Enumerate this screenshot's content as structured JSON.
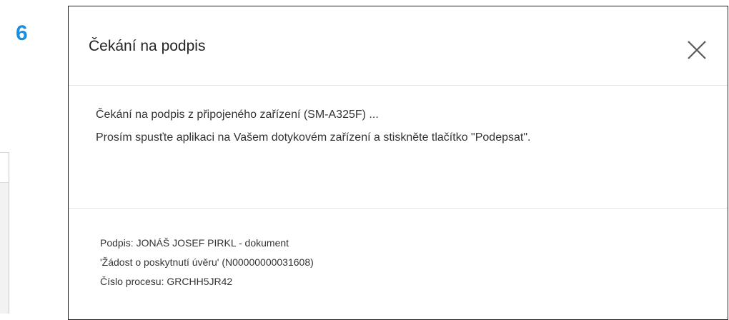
{
  "step": {
    "number": "6"
  },
  "dialog": {
    "title": "Čekání na podpis",
    "close_icon": "close-icon",
    "body": {
      "line1": "Čekání na podpis z připojeného zařízení (SM-A325F) ...",
      "line2": "Prosím spusťte aplikaci na Vašem dotykovém zařízení a stiskněte tlačítko \"Podepsat\"."
    },
    "footer": {
      "line1": "Podpis: JONÁŠ JOSEF PIRKL - dokument",
      "line2": "'Žádost o poskytnutí úvěru' (N00000000031608)",
      "line3": "Číslo procesu: GRCHH5JR42"
    }
  },
  "colors": {
    "step_number": "#1a8fe0",
    "border": "#1f1f1f",
    "divider": "#e6e6e6",
    "text": "#333333"
  }
}
